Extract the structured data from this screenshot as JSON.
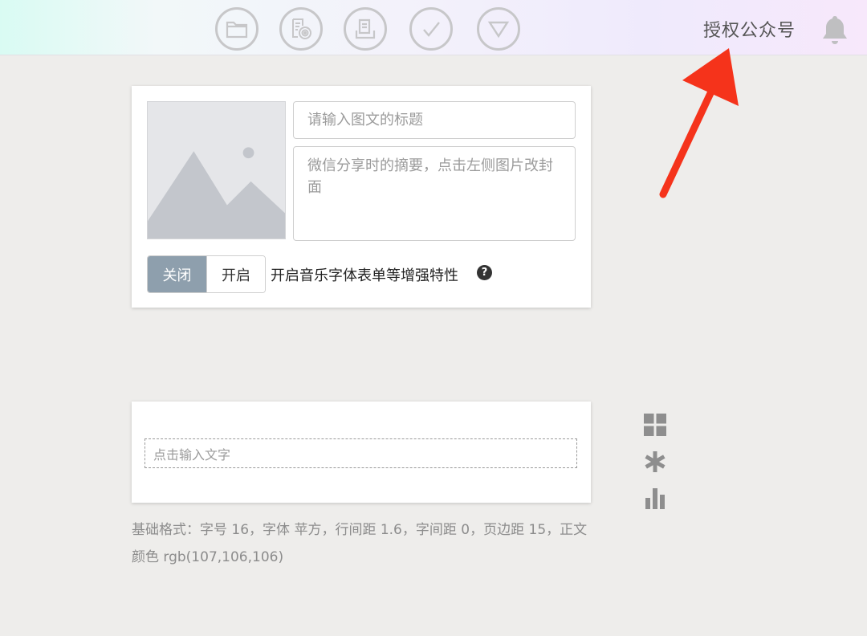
{
  "toolbar": {
    "items": [
      {
        "name": "folder-icon"
      },
      {
        "name": "preview-icon"
      },
      {
        "name": "clipboard-icon"
      },
      {
        "name": "check-icon"
      },
      {
        "name": "triangle-down-icon"
      }
    ],
    "auth_link": "授权公众号",
    "bell_icon": "bell-icon"
  },
  "article": {
    "title_placeholder": "请输入图文的标题",
    "summary_placeholder": "微信分享时的摘要，点击左侧图片改封面",
    "toggle": {
      "off_label": "关闭",
      "on_label": "开启",
      "selected": "关闭"
    },
    "enhance_label": "开启音乐字体表单等增强特性",
    "help_icon": "?"
  },
  "editor": {
    "text_placeholder": "点击输入文字"
  },
  "side_tools": [
    "grid-icon",
    "asterisk-icon",
    "bar-chart-icon"
  ],
  "format_info": "基础格式：字号 16，字体 苹方，行间距 1.6，字间距 0，页边距 15，正文颜色 rgb(107,106,106)",
  "colors": {
    "toggle_active": "#8e9fad",
    "arrow": "#f5331b",
    "icon_gray": "#c7c7c9"
  }
}
